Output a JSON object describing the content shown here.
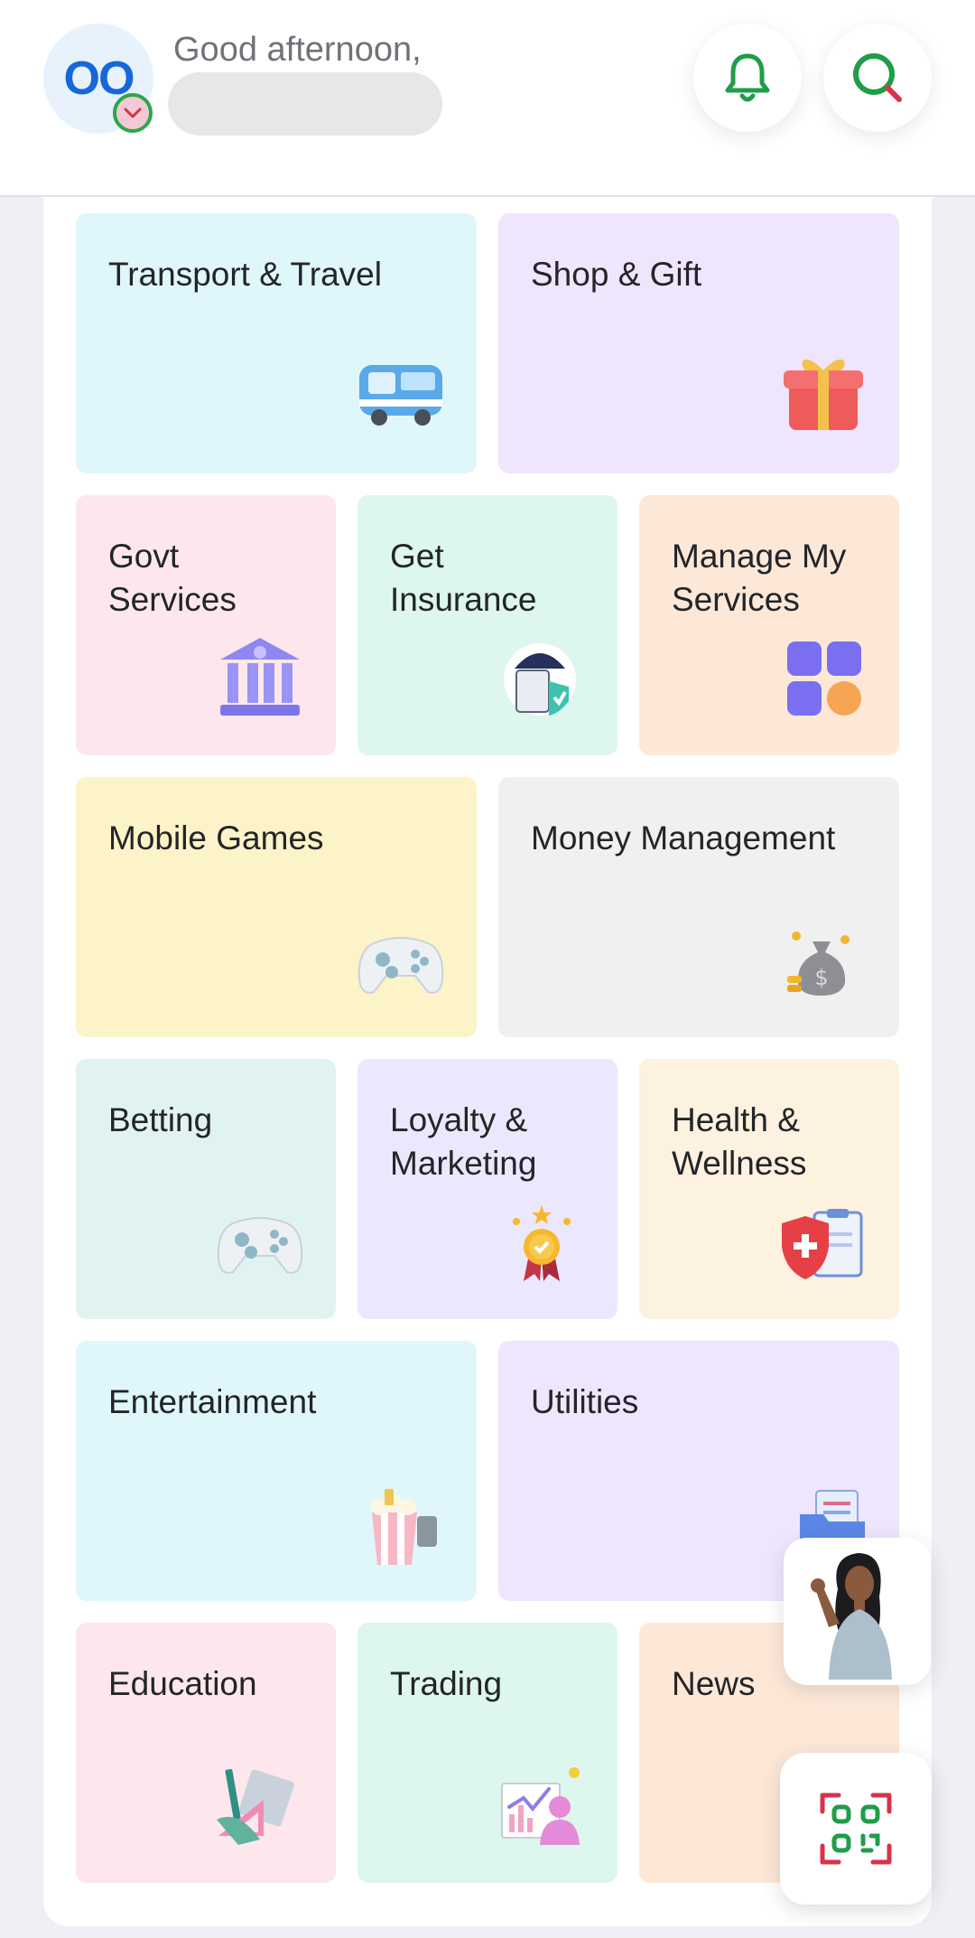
{
  "header": {
    "avatar_initials": "OO",
    "greeting": "Good afternoon,",
    "icons": {
      "avatar_badge": "chevron-down-icon",
      "bell": "bell-icon",
      "search": "search-icon"
    }
  },
  "colors": {
    "brand_green": "#1f9d48",
    "brand_red": "#d6334a",
    "avatar_blue": "#1667d9"
  },
  "categories": [
    {
      "label": "Transport & Travel",
      "icon": "bus-icon",
      "color": "#dff7fb"
    },
    {
      "label": "Shop & Gift",
      "icon": "gift-icon",
      "color": "#efe5fd"
    },
    {
      "label": "Govt\nServices",
      "icon": "government-building-icon",
      "color": "#fde7ec"
    },
    {
      "label": "Get\nInsurance",
      "icon": "insurance-umbrella-icon",
      "color": "#ddf6ee"
    },
    {
      "label": "Manage My\nServices",
      "icon": "app-grid-icon",
      "color": "#fde8d8"
    },
    {
      "label": "Mobile Games",
      "icon": "game-controller-icon",
      "color": "#fdf3c8"
    },
    {
      "label": "Money Management",
      "icon": "money-bag-icon",
      "color": "#f0f0f1"
    },
    {
      "label": "Betting",
      "icon": "game-controller-icon",
      "color": "#e0f3f1"
    },
    {
      "label": "Loyalty &\nMarketing",
      "icon": "medal-icon",
      "color": "#ebe8fd"
    },
    {
      "label": "Health &\nWellness",
      "icon": "health-shield-icon",
      "color": "#fdf1df"
    },
    {
      "label": "Entertainment",
      "icon": "popcorn-icon",
      "color": "#dff7fb"
    },
    {
      "label": "Utilities",
      "icon": "documents-folder-icon",
      "color": "#efe5fd"
    },
    {
      "label": "Education",
      "icon": "geometry-tools-icon",
      "color": "#fde7ec"
    },
    {
      "label": "Trading",
      "icon": "trading-chart-icon",
      "color": "#ddf6ee"
    },
    {
      "label": "News",
      "icon": "news-icon",
      "color": "#fde8d8"
    }
  ],
  "floating": {
    "assistant_icon": "assistant-avatar-icon",
    "scan_icon": "qr-scan-icon"
  }
}
